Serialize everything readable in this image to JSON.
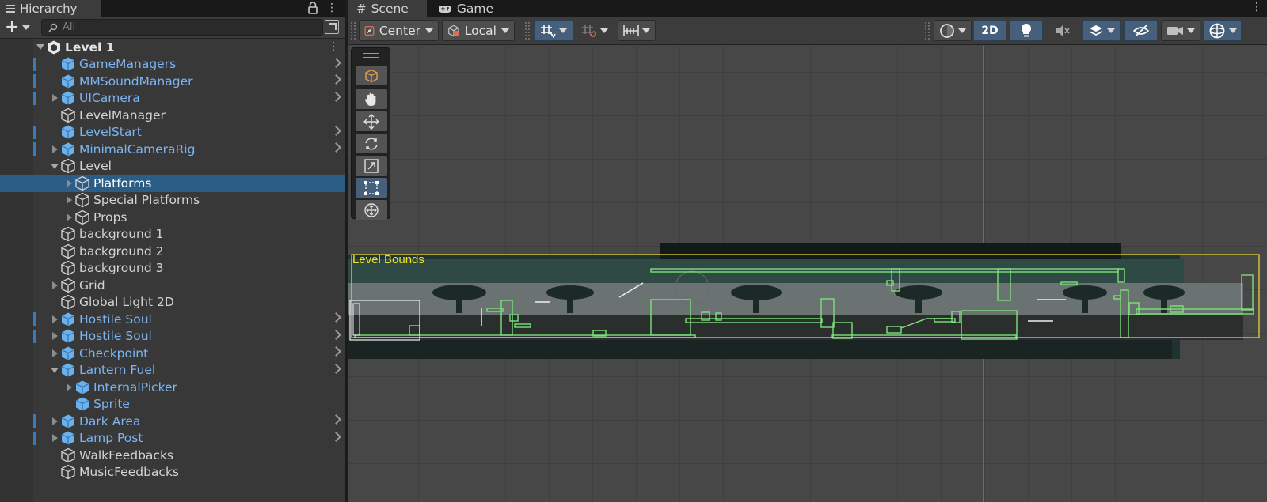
{
  "hierarchy": {
    "tab_label": "Hierarchy",
    "search_placeholder": "All",
    "rows": [
      {
        "label": "Level 1",
        "indent": 0,
        "fold": "down",
        "kind": "scene",
        "chev": false,
        "bar": false,
        "kebab": true
      },
      {
        "label": "GameManagers",
        "indent": 1,
        "fold": "none",
        "kind": "prefab",
        "chev": true,
        "bar": true
      },
      {
        "label": "MMSoundManager",
        "indent": 1,
        "fold": "none",
        "kind": "prefab",
        "chev": true,
        "bar": true
      },
      {
        "label": "UICamera",
        "indent": 1,
        "fold": "right",
        "kind": "prefab",
        "chev": true,
        "bar": true
      },
      {
        "label": "LevelManager",
        "indent": 1,
        "fold": "none",
        "kind": "plain",
        "chev": false,
        "bar": false
      },
      {
        "label": "LevelStart",
        "indent": 1,
        "fold": "none",
        "kind": "prefab",
        "chev": true,
        "bar": true
      },
      {
        "label": "MinimalCameraRig",
        "indent": 1,
        "fold": "right",
        "kind": "prefab",
        "chev": true,
        "bar": true
      },
      {
        "label": "Level",
        "indent": 1,
        "fold": "down",
        "kind": "plain",
        "chev": false,
        "bar": false
      },
      {
        "label": "Platforms",
        "indent": 2,
        "fold": "right",
        "kind": "plain",
        "chev": false,
        "bar": false,
        "selected": true
      },
      {
        "label": "Special Platforms",
        "indent": 2,
        "fold": "right",
        "kind": "plain",
        "chev": false,
        "bar": false
      },
      {
        "label": "Props",
        "indent": 2,
        "fold": "right",
        "kind": "plain",
        "chev": false,
        "bar": false
      },
      {
        "label": "background 1",
        "indent": 1,
        "fold": "none",
        "kind": "plain",
        "chev": false,
        "bar": false
      },
      {
        "label": "background 2",
        "indent": 1,
        "fold": "none",
        "kind": "plain",
        "chev": false,
        "bar": false
      },
      {
        "label": "background 3",
        "indent": 1,
        "fold": "none",
        "kind": "plain",
        "chev": false,
        "bar": false
      },
      {
        "label": "Grid",
        "indent": 1,
        "fold": "right",
        "kind": "plain",
        "chev": false,
        "bar": false
      },
      {
        "label": "Global Light 2D",
        "indent": 1,
        "fold": "none",
        "kind": "plain",
        "chev": false,
        "bar": false
      },
      {
        "label": "Hostile Soul",
        "indent": 1,
        "fold": "right",
        "kind": "prefab",
        "chev": true,
        "bar": true
      },
      {
        "label": "Hostile Soul",
        "indent": 1,
        "fold": "right",
        "kind": "prefab",
        "chev": true,
        "bar": true
      },
      {
        "label": "Checkpoint",
        "indent": 1,
        "fold": "right",
        "kind": "prefab",
        "chev": true,
        "bar": false
      },
      {
        "label": "Lantern Fuel",
        "indent": 1,
        "fold": "down",
        "kind": "prefab",
        "chev": true,
        "bar": false
      },
      {
        "label": "InternalPicker",
        "indent": 2,
        "fold": "right",
        "kind": "prefab",
        "chev": false,
        "bar": false
      },
      {
        "label": "Sprite",
        "indent": 2,
        "fold": "none",
        "kind": "prefab",
        "chev": false,
        "bar": false
      },
      {
        "label": "Dark Area",
        "indent": 1,
        "fold": "right",
        "kind": "prefab",
        "chev": true,
        "bar": true
      },
      {
        "label": "Lamp Post",
        "indent": 1,
        "fold": "right",
        "kind": "prefab",
        "chev": true,
        "bar": true
      },
      {
        "label": "WalkFeedbacks",
        "indent": 1,
        "fold": "none",
        "kind": "plain",
        "chev": false,
        "bar": false
      },
      {
        "label": "MusicFeedbacks",
        "indent": 1,
        "fold": "none",
        "kind": "plain",
        "chev": false,
        "bar": false
      }
    ]
  },
  "scene": {
    "tab_scene": "Scene",
    "tab_game": "Game",
    "pivot_mode": "Center",
    "pivot_rotation": "Local",
    "mode_2d": "2D",
    "level_bounds_label": "Level Bounds"
  },
  "colors": {
    "prefab_text": "#7cb4f2",
    "selection": "#2c5d87",
    "collider": "#7de07a",
    "bounds": "#f2e02f",
    "active_button": "#46607c"
  },
  "icons": [
    "hierarchy-menu-icon",
    "lock-icon",
    "kebab-icon",
    "add-icon",
    "search-icon",
    "pick-icon",
    "grid-tab-icon",
    "gamepad-icon",
    "pivot-center-icon",
    "local-rotation-icon",
    "grid-snap-icon",
    "increment-snap-icon",
    "ruler-icon",
    "shading-icon",
    "light-icon",
    "audio-icon",
    "effects-icon",
    "hidden-icon",
    "camera-icon",
    "gizmos-icon",
    "view-tool-icon",
    "move-tool-icon",
    "rotate-tool-icon",
    "scale-tool-icon",
    "rect-tool-icon",
    "transform-tool-icon",
    "custom-tool-icon"
  ]
}
